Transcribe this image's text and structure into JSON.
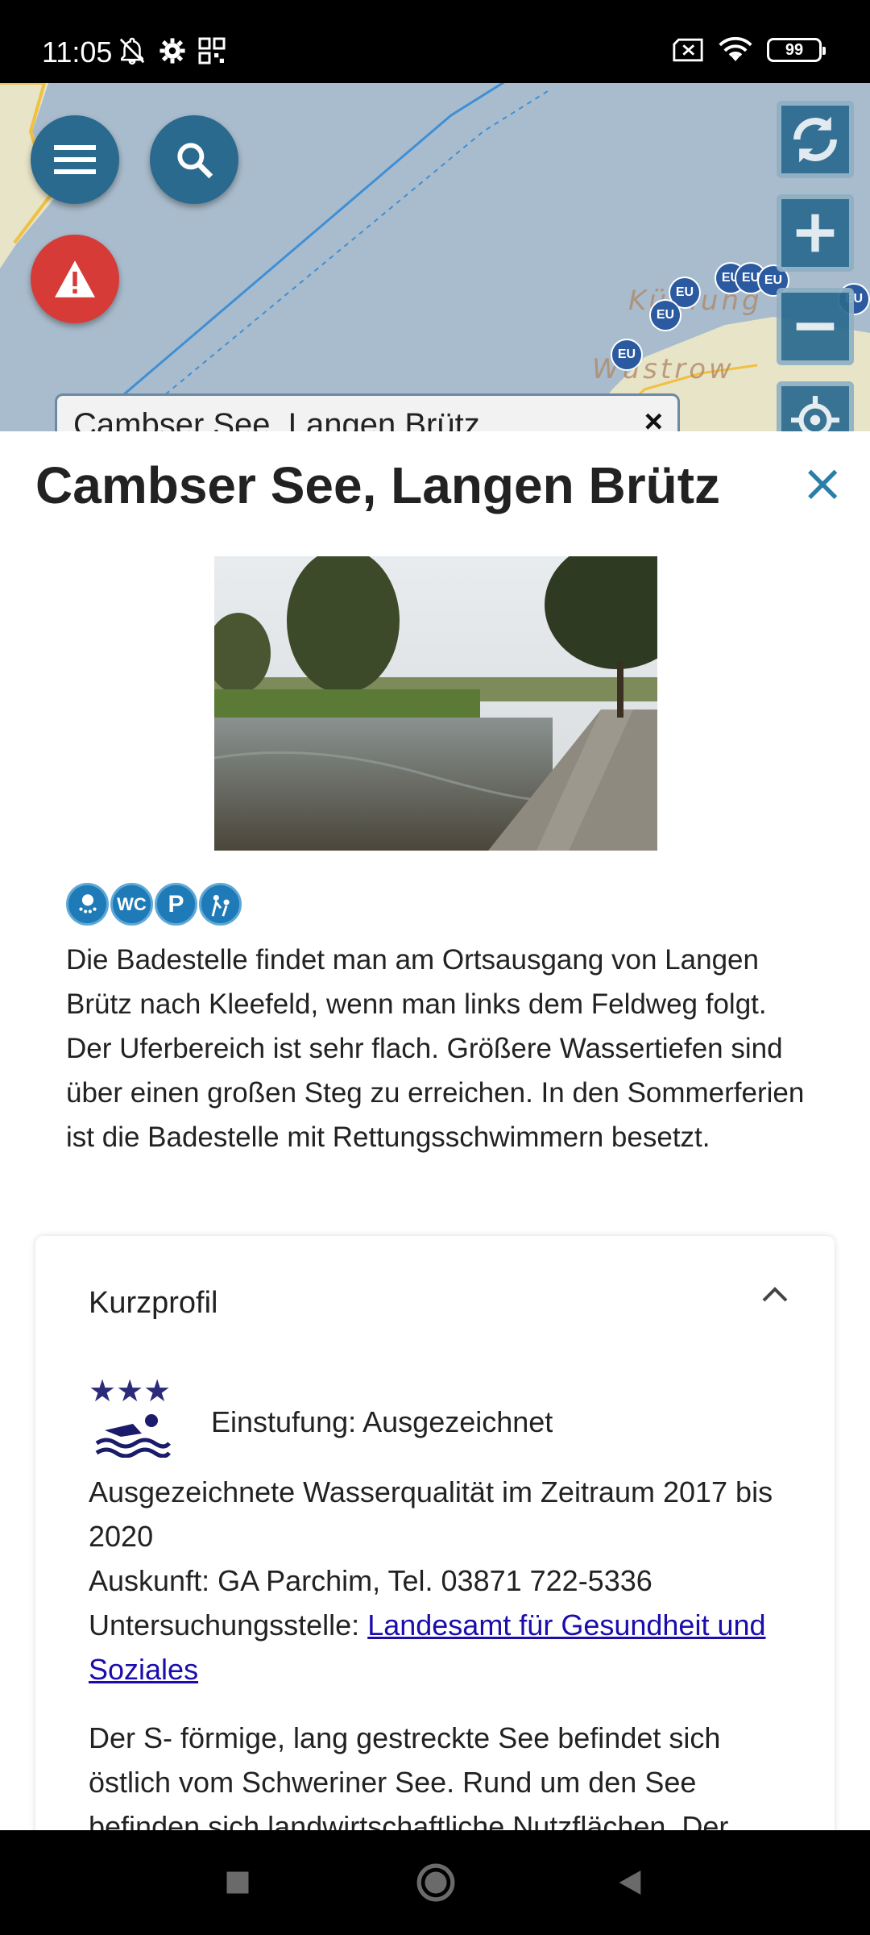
{
  "status_bar": {
    "time": "11:05",
    "battery": "99"
  },
  "map": {
    "labels": [
      "Kühlung",
      "Wustrow"
    ],
    "marker_label": "EU",
    "search_chip_text": "Cambser See, Langen Brütz",
    "search_chip_clear": "×"
  },
  "sheet": {
    "title": "Cambser See, Langen Brütz",
    "close": "×",
    "amenities": [
      "WC",
      "P"
    ],
    "description": "Die Badestelle findet man am Ortsausgang von Langen Brütz nach Kleefeld, wenn man links dem Feldweg folgt. Der Uferbereich ist sehr flach. Größere Wassertiefen sind über einen großen Steg zu erreichen. In den Sommerferien ist die Badestelle mit Rettungsschwimmern besetzt.",
    "card": {
      "header": "Kurzprofil",
      "stars": "★★★",
      "rating_label": "Einstufung: Ausgezeichnet",
      "quality": "Ausgezeichnete Wasserqualität im Zeitraum 2017 bis 2020",
      "auskunft": "Auskunft: GA Parchim, Tel. 03871 722-5336",
      "untersuchung_prefix": "Untersuchungsstelle: ",
      "untersuchung_link": "Landesamt für Gesundheit und Soziales",
      "lake_text": "Der S- förmige, lang gestreckte See befindet sich östlich vom Schweriner See. Rund um den See befinden sich landwirtschaftliche Nutzflächen. Der"
    }
  },
  "colors": {
    "accent": "#2a6a8f",
    "warning": "#d63b38",
    "link": "#1a0dab"
  }
}
